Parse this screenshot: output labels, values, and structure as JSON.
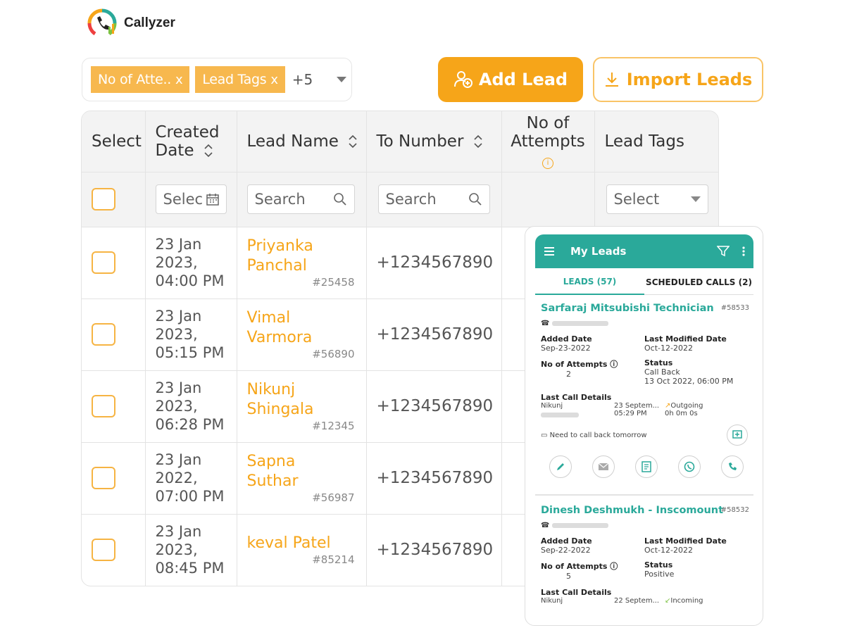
{
  "brand": {
    "name": "Callyzer"
  },
  "filters": {
    "chips": [
      {
        "label": "No of Atte..",
        "remove": "x"
      },
      {
        "label": "Lead Tags",
        "remove": "x"
      }
    ],
    "more": "+5"
  },
  "actions": {
    "add_lead": "Add Lead",
    "import_leads": "Import Leads"
  },
  "table": {
    "headers": {
      "select": "Select",
      "created_date": [
        "Created",
        "Date"
      ],
      "lead_name": "Lead Name",
      "to_number": "To Number",
      "attempts": [
        "No of",
        "Attempts"
      ],
      "lead_tags": "Lead Tags"
    },
    "filter_row": {
      "date_placeholder": "Selec",
      "name_placeholder": "Search",
      "number_placeholder": "Search",
      "tags_placeholder": "Select"
    },
    "rows": [
      {
        "date": [
          "23 Jan",
          "2023,",
          "04:00 PM"
        ],
        "name": [
          "Priyanka",
          "Panchal"
        ],
        "id": "#25458",
        "number": "+1234567890"
      },
      {
        "date": [
          "23 Jan",
          "2023,",
          "05:15 PM"
        ],
        "name": [
          "Vimal",
          "Varmora"
        ],
        "id": "#56890",
        "number": "+1234567890"
      },
      {
        "date": [
          "23 Jan",
          "2023,",
          "06:28 PM"
        ],
        "name": [
          "Nikunj",
          "Shingala"
        ],
        "id": "#12345",
        "number": "+1234567890"
      },
      {
        "date": [
          "23 Jan",
          "2022,",
          "07:00 PM"
        ],
        "name": [
          "Sapna",
          "Suthar"
        ],
        "id": "#56987",
        "number": "+1234567890"
      },
      {
        "date": [
          "23 Jan",
          "2023,",
          "08:45 PM"
        ],
        "name": [
          "keval Patel",
          ""
        ],
        "id": "#85214",
        "number": "+1234567890"
      }
    ]
  },
  "mobile": {
    "title": "My Leads",
    "tabs": {
      "leads": "LEADS (57)",
      "scheduled": "SCHEDULED CALLS (2)"
    },
    "cards": [
      {
        "name": "Sarfaraj Mitsubishi Technician",
        "id": "#58533",
        "added_label": "Added Date",
        "added": "Sep-23-2022",
        "modified_label": "Last Modified Date",
        "modified": "Oct-12-2022",
        "attempts_label": "No of Attempts",
        "attempts": "2",
        "status_label": "Status",
        "status": "Call Back",
        "status_time": "13 Oct 2022, 06:00 PM",
        "last_call_label": "Last Call Details",
        "caller": "Nikunj",
        "call_date": "23 Septem...",
        "call_time": "05:29 PM",
        "direction": "Outgoing",
        "duration": "0h 0m 0s",
        "note": "Need to call back tomorrow"
      },
      {
        "name": "Dinesh Deshmukh - Inscomount",
        "id": "#58532",
        "added_label": "Added Date",
        "added": "Sep-22-2022",
        "modified_label": "Last Modified Date",
        "modified": "Oct-12-2022",
        "attempts_label": "No of Attempts",
        "attempts": "5",
        "status_label": "Status",
        "status": "Positive",
        "last_call_label": "Last Call Details",
        "caller": "Nikunj",
        "call_date": "22 Septem...",
        "direction": "Incoming"
      }
    ]
  },
  "colors": {
    "accent": "#f6a519",
    "teal": "#2aa99a"
  }
}
